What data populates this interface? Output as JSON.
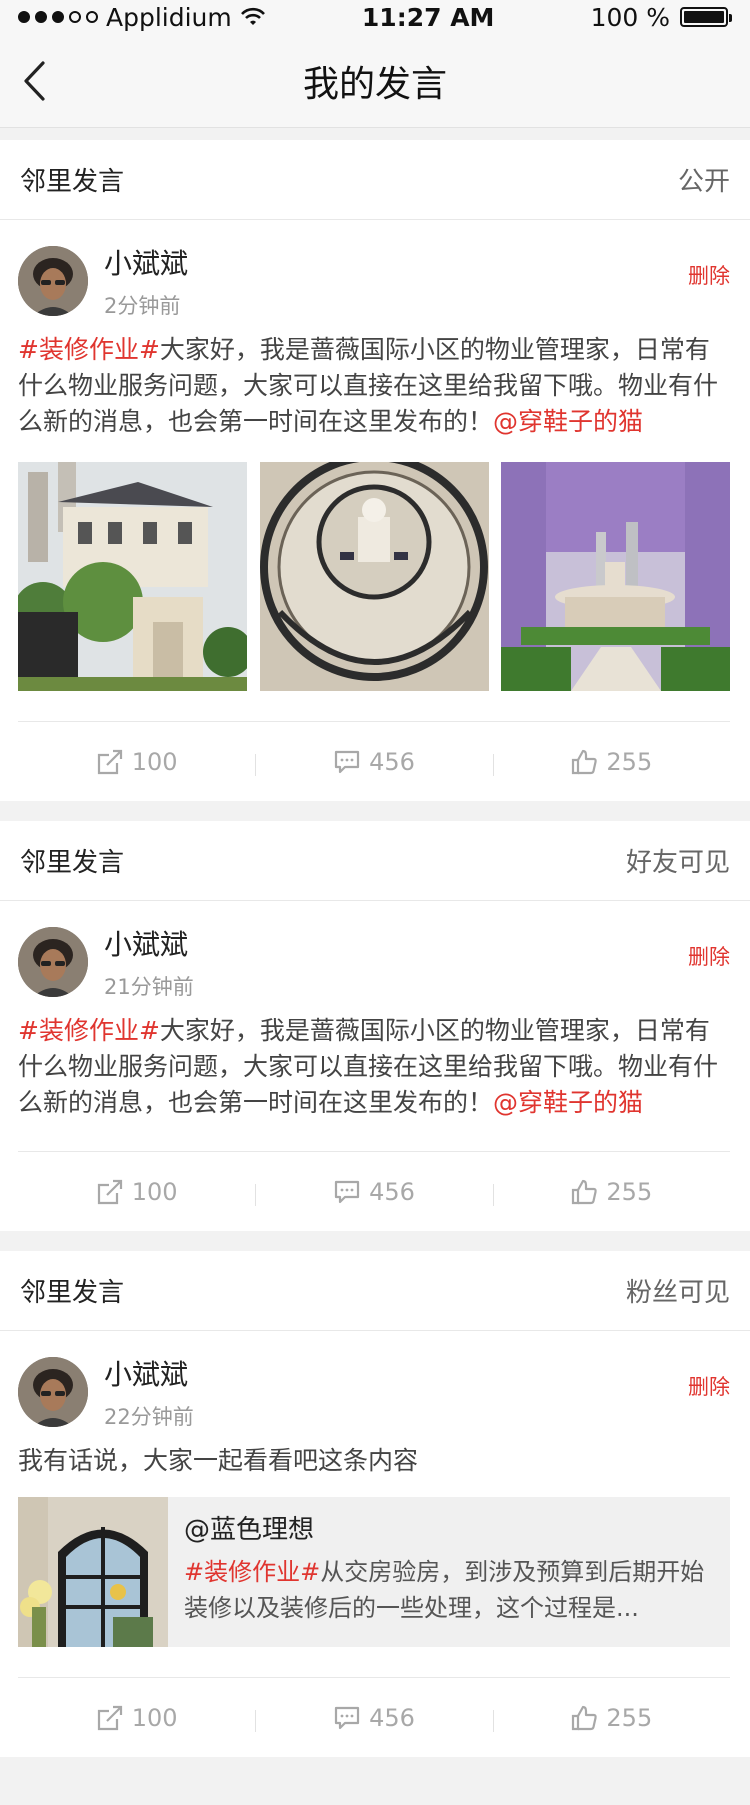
{
  "status_bar": {
    "carrier": "Applidium",
    "time": "11:27 AM",
    "battery": "100 %",
    "signal_dots_filled": 3,
    "signal_dots_total": 5,
    "battery_level": 1.0
  },
  "nav": {
    "title": "我的发言",
    "back_icon": "chevron-left-icon"
  },
  "colors": {
    "accent": "#e0352f",
    "muted": "#a8a8a8",
    "background": "#f2f2f2"
  },
  "posts": [
    {
      "header": "邻里发言",
      "visibility": "公开",
      "author": "小斌斌",
      "time": "2分钟前",
      "delete": "删除",
      "tag": "#装修作业#",
      "text": "大家好，我是蔷薇国际小区的物业管理家，日常有什么物业服务问题，大家可以直接在这里给我留下哦。物业有什么新的消息，也会第一时间在这里发布的！",
      "mention": "@穿鞋子的猫",
      "shares": "100",
      "comments": "456",
      "likes": "255"
    },
    {
      "header": "邻里发言",
      "visibility": "好友可见",
      "author": "小斌斌",
      "time": "21分钟前",
      "delete": "删除",
      "tag": "#装修作业#",
      "text": "大家好，我是蔷薇国际小区的物业管理家，日常有什么物业服务问题，大家可以直接在这里给我留下哦。物业有什么新的消息，也会第一时间在这里发布的！",
      "mention": "@穿鞋子的猫",
      "shares": "100",
      "comments": "456",
      "likes": "255"
    },
    {
      "header": "邻里发言",
      "visibility": "粉丝可见",
      "author": "小斌斌",
      "time": "22分钟前",
      "delete": "删除",
      "text": "我有话说，大家一起看看吧这条内容",
      "quote": {
        "author": "@蓝色理想",
        "tag": "#装修作业#",
        "text": "从交房验房，到涉及预算到后期开始装修以及装修后的一些处理，这个过程是..."
      },
      "shares": "100",
      "comments": "456",
      "likes": "255"
    }
  ]
}
